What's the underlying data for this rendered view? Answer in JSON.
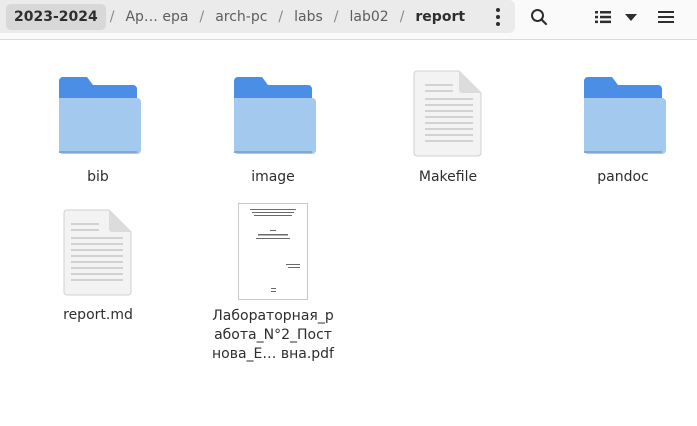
{
  "pathbar": {
    "crumbs": [
      "2023-2024",
      "Ар… ера",
      "arch-pc",
      "labs",
      "lab02",
      "report"
    ],
    "separator": "/"
  },
  "toolbar": {
    "menu_icon": "vertical-dots-icon",
    "search_icon": "search-icon",
    "view_icon": "list-view-icon",
    "view_dropdown_icon": "chevron-down-icon",
    "main_menu_icon": "hamburger-menu-icon"
  },
  "files": [
    {
      "name": "bib",
      "kind": "folder"
    },
    {
      "name": "image",
      "kind": "folder"
    },
    {
      "name": "Makefile",
      "kind": "text"
    },
    {
      "name": "pandoc",
      "kind": "folder"
    },
    {
      "name": "report.md",
      "kind": "text"
    },
    {
      "name": "Лабораторная_работа_N°2_Постнова_Е… вна.pdf",
      "kind": "pdf",
      "label_lines": [
        "Лабораторная_р",
        "абота_N°2_Пост",
        "нова_Е… вна.pdf"
      ]
    }
  ],
  "colors": {
    "folder_back": "#4a8ee6",
    "folder_front": "#a4c9ef",
    "pathbar_bg": "#ebebeb",
    "active_crumb_bg": "#d8d8d8"
  }
}
